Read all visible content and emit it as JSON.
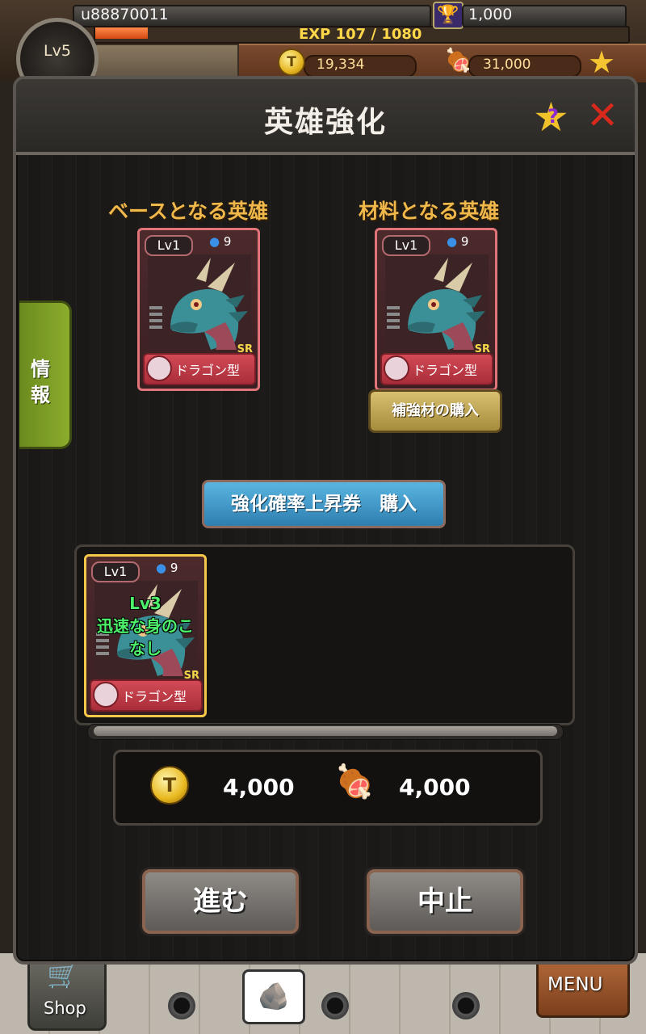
{
  "hud": {
    "username": "u88870011",
    "level": "Lv5",
    "exp_text": "EXP 107 / 1080",
    "exp_progress": 0.099,
    "trophies": "1,000",
    "coins": "19,334",
    "meat": "31,000",
    "help_icon": "?"
  },
  "dialog": {
    "title": "英雄強化",
    "help_icon": "?",
    "close_icon": "✕",
    "side_tab": [
      "情",
      "報"
    ],
    "base_label": "ベースとなる英雄",
    "material_label": "材料となる英雄",
    "base_card": {
      "level": "Lv1",
      "mp": "9",
      "rarity": "SR",
      "type": "ドラゴン型"
    },
    "material_card": {
      "level": "Lv1",
      "mp": "9",
      "rarity": "SR",
      "type": "ドラゴン型"
    },
    "buy_material_button": "補強材の購入",
    "buy_ticket_button": "強化確率上昇券　購入",
    "material_list": [
      {
        "level": "Lv1",
        "mp": "9",
        "rarity": "SR",
        "type": "ドラゴン型",
        "skill_level": "Lv3",
        "skill_name_1": "迅速な身のこ",
        "skill_name_2": "なし"
      }
    ],
    "cost_coin": "4,000",
    "cost_meat": "4,000",
    "proceed_button": "進む",
    "cancel_button": "中止"
  },
  "bottom_nav": {
    "shop_label": "Shop",
    "menu_label": "MENU"
  },
  "colors": {
    "accent_gold": "#f0b84a",
    "card_border": "#e07479",
    "selected_border": "#f4c94a",
    "skill_green": "#4cf26a"
  }
}
